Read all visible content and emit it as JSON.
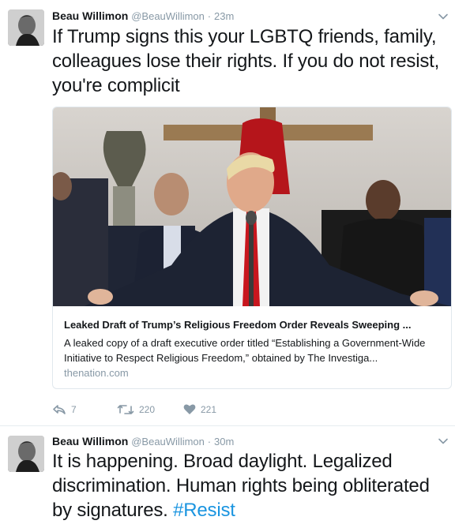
{
  "tweets": [
    {
      "display_name": "Beau Willimon",
      "handle": "@BeauWillimon",
      "separator": "·",
      "time": "23m",
      "text": "If Trump signs this your LGBTQ friends, family, colleagues lose their rights. If you do not resist, you're complicit",
      "card": {
        "title": "Leaked Draft of Trump’s Religious Freedom Order Reveals Sweeping ...",
        "description": "A leaked copy of a draft executive order titled “Establishing a Government-Wide Initiative to Respect Religious Freedom,” obtained by The Investiga...",
        "domain": "thenation.com"
      },
      "actions": {
        "reply_count": "7",
        "retweet_count": "220",
        "like_count": "221"
      }
    },
    {
      "display_name": "Beau Willimon",
      "handle": "@BeauWillimon",
      "separator": "·",
      "time": "30m",
      "text_main": "It is happening. Broad daylight. Legalized discrimination. Human rights being obliterated by signatures. ",
      "hashtag": "#Resist"
    }
  ],
  "icons": {
    "menu": "chevron-down-icon",
    "reply": "reply-icon",
    "retweet": "retweet-icon",
    "like": "heart-icon"
  },
  "colors": {
    "text": "#14171a",
    "muted": "#8899a6",
    "link": "#1b95e0",
    "border": "#e1e8ed"
  }
}
